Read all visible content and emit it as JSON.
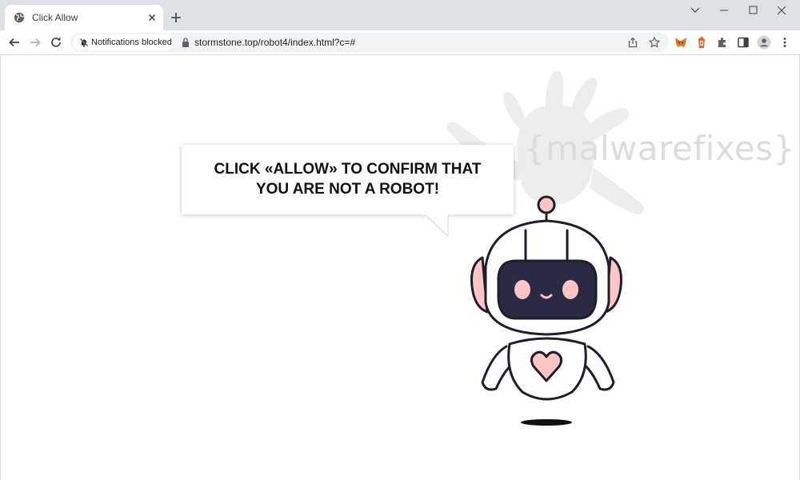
{
  "browser": {
    "tab": {
      "title": "Click Allow",
      "favicon": "globe-icon",
      "close_icon": "close-icon"
    },
    "new_tab_icon": "plus-icon",
    "window_controls": [
      "chevron-down-icon",
      "minimize-icon",
      "maximize-icon",
      "close-icon"
    ],
    "nav": [
      "back-arrow-icon",
      "forward-arrow-icon",
      "reload-icon"
    ],
    "notification_chip": {
      "label": "Notifications blocked",
      "icon": "bell-off-icon"
    },
    "url": "stormstone.top/robot4/index.html?c=#",
    "omnibox_icons": [
      "share-icon",
      "star-icon"
    ],
    "extensions": [
      "metamask-fox-icon",
      "extension-orange-icon",
      "puzzle-icon",
      "side-panel-icon",
      "profile-icon",
      "more-vert-icon"
    ]
  },
  "page": {
    "message": "CLICK «ALLOW» TO CONFIRM THAT YOU ARE NOT A ROBOT!",
    "watermark": "{malwarefixes}",
    "accent_pink": "#ffc4c4",
    "robot_outline": "#1e1e2e"
  }
}
